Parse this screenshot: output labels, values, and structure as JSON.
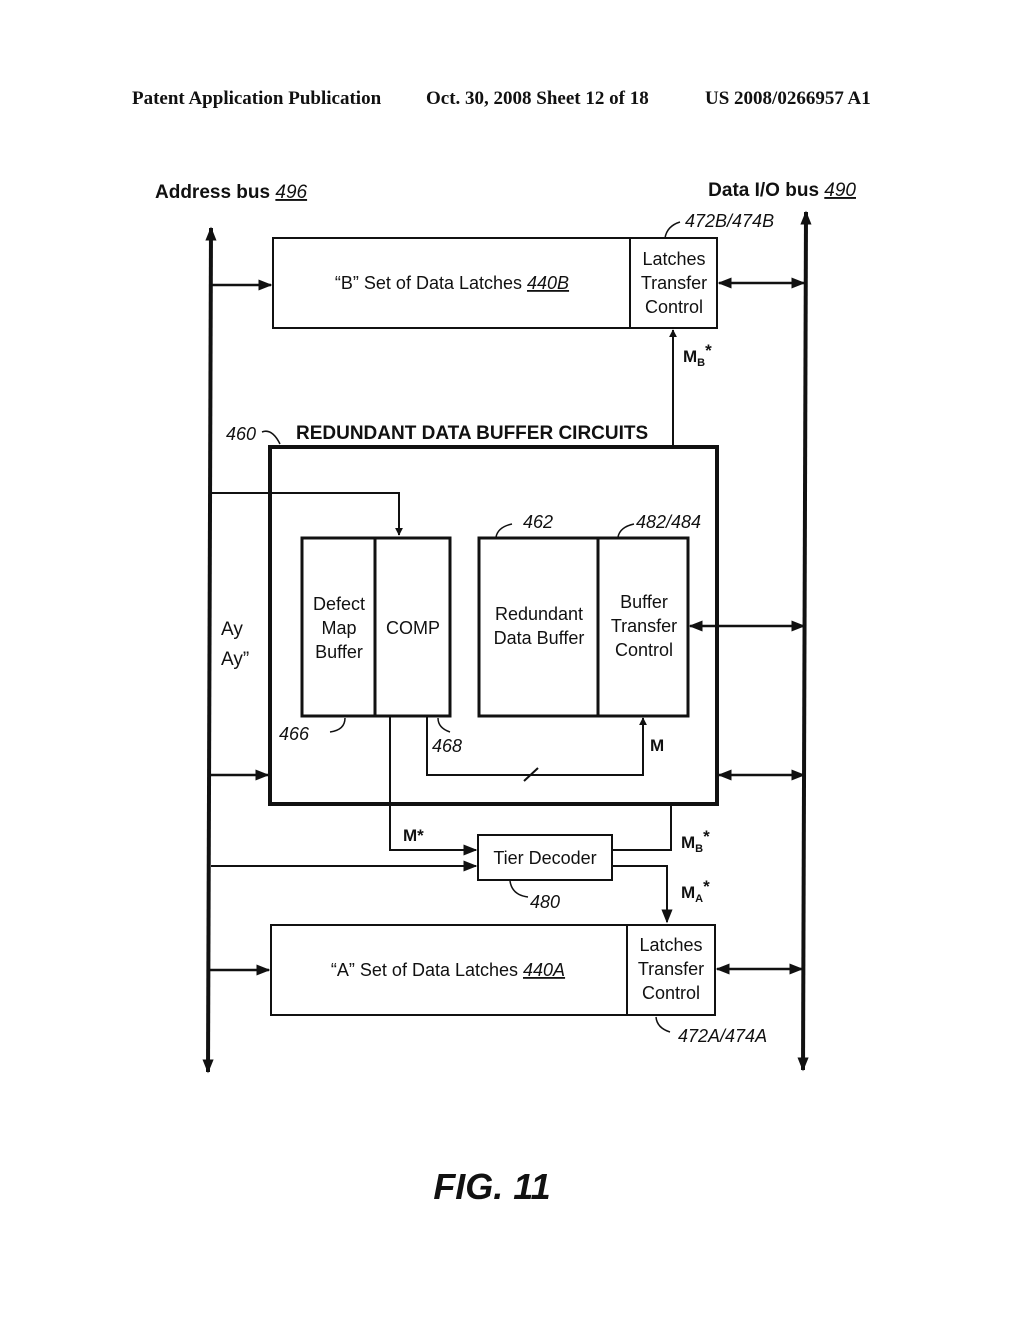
{
  "header": {
    "publication": "Patent Application Publication",
    "date_sheet": "Oct. 30, 2008  Sheet 12 of 18",
    "patent_number": "US 2008/0266957 A1"
  },
  "diagram": {
    "address_bus": {
      "label": "Address bus ",
      "ref": "496"
    },
    "data_bus": {
      "label": "Data I/O bus ",
      "ref": "490"
    },
    "latches_b": {
      "label": "“B” Set of Data Latches ",
      "ref": "440B",
      "control_lines": [
        "Latches",
        "Transfer",
        "Control"
      ],
      "control_ref": "472B/474B"
    },
    "latches_a": {
      "label": "“A” Set of Data Latches ",
      "ref": "440A",
      "control_lines": [
        "Latches",
        "Transfer",
        "Control"
      ],
      "control_ref": "472A/474A"
    },
    "rdbc": {
      "ref": "460",
      "title": "REDUNDANT DATA BUFFER CIRCUITS"
    },
    "defect_map": {
      "lines": [
        "Defect",
        "Map",
        "Buffer"
      ],
      "ref": "466"
    },
    "comp": {
      "label": "COMP",
      "ref": "468"
    },
    "redundant_buffer": {
      "lines": [
        "Redundant",
        "Data Buffer"
      ],
      "ref": "462"
    },
    "buffer_transfer": {
      "lines": [
        "Buffer",
        "Transfer",
        "Control"
      ],
      "ref": "482/484"
    },
    "tier_decoder": {
      "label": "Tier Decoder",
      "ref": "480"
    },
    "address_inputs": [
      "Ay",
      "Ay”"
    ],
    "signals": {
      "m": "M",
      "m_star": "M*",
      "mb_base": "M",
      "mb_sub": "B",
      "ma_base": "M",
      "ma_sub": "A",
      "star": "*"
    }
  },
  "figure_label": "FIG. 11"
}
